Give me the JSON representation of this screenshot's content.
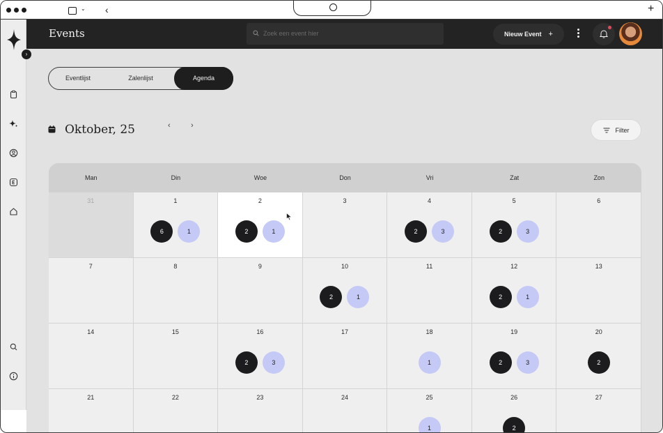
{
  "app": {
    "title": "Events",
    "colors": {
      "accent_dark": "#1c1c1e",
      "accent_light": "#c5c9f5",
      "notification": "#e3485a"
    }
  },
  "header": {
    "search_placeholder": "Zoek een event hier",
    "new_event_label": "Nieuw Event",
    "new_event_icon": "plus-icon",
    "menu_icon": "kebab-menu-icon",
    "notification_icon": "bell-icon"
  },
  "sidebar": {
    "icons": [
      "clipboard-icon",
      "sparkle-icon",
      "user-circle-icon",
      "e-letter-icon",
      "home-icon",
      "search-icon",
      "info-icon"
    ]
  },
  "view_tabs": [
    {
      "label": "Eventlijst",
      "active": false
    },
    {
      "label": "Zalenlijst",
      "active": false
    },
    {
      "label": "Agenda",
      "active": true
    }
  ],
  "calendar": {
    "month_label": "Oktober, 25",
    "filter_label": "Filter",
    "day_names": [
      "Man",
      "Din",
      "Woe",
      "Don",
      "Vri",
      "Zat",
      "Zon"
    ],
    "weeks": [
      [
        {
          "day": "31",
          "muted": true,
          "dark": null,
          "light": null
        },
        {
          "day": "1",
          "dark": "6",
          "light": "1"
        },
        {
          "day": "2",
          "today": true,
          "dark": "2",
          "light": "1"
        },
        {
          "day": "3",
          "dark": null,
          "light": null
        },
        {
          "day": "4",
          "dark": "2",
          "light": "3"
        },
        {
          "day": "5",
          "dark": "2",
          "light": "3"
        },
        {
          "day": "6",
          "dark": null,
          "light": null
        }
      ],
      [
        {
          "day": "7",
          "dark": null,
          "light": null
        },
        {
          "day": "8",
          "dark": null,
          "light": null
        },
        {
          "day": "9",
          "dark": null,
          "light": null
        },
        {
          "day": "10",
          "dark": "2",
          "light": "1"
        },
        {
          "day": "11",
          "dark": null,
          "light": null
        },
        {
          "day": "12",
          "dark": "2",
          "light": "1"
        },
        {
          "day": "13",
          "dark": null,
          "light": null
        }
      ],
      [
        {
          "day": "14",
          "dark": null,
          "light": null
        },
        {
          "day": "15",
          "dark": null,
          "light": null
        },
        {
          "day": "16",
          "dark": "2",
          "light": "3"
        },
        {
          "day": "17",
          "dark": null,
          "light": null
        },
        {
          "day": "18",
          "dark": null,
          "light": "1"
        },
        {
          "day": "19",
          "dark": "2",
          "light": "3"
        },
        {
          "day": "20",
          "dark": "2",
          "light": null
        }
      ],
      [
        {
          "day": "21",
          "dark": null,
          "light": null
        },
        {
          "day": "22",
          "dark": null,
          "light": null
        },
        {
          "day": "23",
          "dark": null,
          "light": null
        },
        {
          "day": "24",
          "dark": null,
          "light": null
        },
        {
          "day": "25",
          "dark": null,
          "light": "1"
        },
        {
          "day": "26",
          "dark": "2",
          "light": null
        },
        {
          "day": "27",
          "dark": null,
          "light": null
        }
      ]
    ]
  }
}
